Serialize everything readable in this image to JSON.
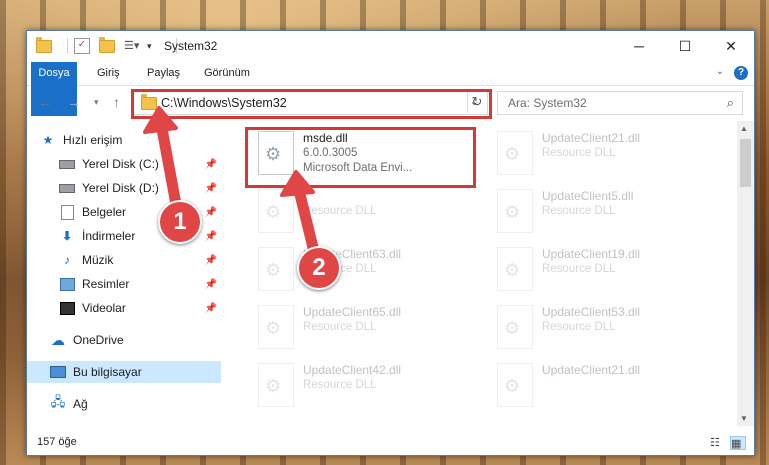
{
  "window": {
    "title": "System32",
    "controls": {
      "minimize": "─",
      "maximize": "☐",
      "close": "✕"
    }
  },
  "ribbon": {
    "tabs": [
      "Dosya",
      "Giriş",
      "Paylaş",
      "Görünüm"
    ]
  },
  "address": {
    "path": "C:\\Windows\\System32",
    "search_placeholder": "Ara: System32"
  },
  "nav": {
    "items": [
      {
        "label": "Hızlı erişim",
        "icon": "star-icon"
      },
      {
        "label": "Yerel Disk (C:)",
        "icon": "drive-icon",
        "pinned": true
      },
      {
        "label": "Yerel Disk (D:)",
        "icon": "drive-icon",
        "pinned": true
      },
      {
        "label": "Belgeler",
        "icon": "documents-icon",
        "pinned": true
      },
      {
        "label": "İndirmeler",
        "icon": "download-icon",
        "pinned": true
      },
      {
        "label": "Müzik",
        "icon": "music-icon",
        "pinned": true
      },
      {
        "label": "Resimler",
        "icon": "pictures-icon",
        "pinned": true
      },
      {
        "label": "Videolar",
        "icon": "videos-icon",
        "pinned": true
      },
      {
        "label": "OneDrive",
        "icon": "cloud-icon"
      },
      {
        "label": "Bu bilgisayar",
        "icon": "computer-icon",
        "selected": true
      },
      {
        "label": "Ağ",
        "icon": "network-icon"
      }
    ]
  },
  "files": [
    {
      "name": "msde.dll",
      "version": "6.0.0.3005",
      "desc": "Microsoft Data Envi..."
    },
    {
      "name": "UpdateClient21.dll",
      "desc": "Resource DLL"
    },
    {
      "name": "",
      "desc": "Resource DLL"
    },
    {
      "name": "UpdateClient5.dll",
      "desc": "Resource DLL"
    },
    {
      "name": "UpdateClient63.dll",
      "desc": "Resource DLL"
    },
    {
      "name": "UpdateClient19.dll",
      "desc": "Resource DLL"
    },
    {
      "name": "UpdateClient65.dll",
      "desc": "Resource DLL"
    },
    {
      "name": "UpdateClient53.dll",
      "desc": "Resource DLL"
    },
    {
      "name": "UpdateClient42.dll",
      "desc": "Resource DLL"
    },
    {
      "name": "UpdateClient21.dll",
      "desc": ""
    }
  ],
  "status": {
    "count": "157 öğe"
  },
  "annotations": {
    "step1": "1",
    "step2": "2"
  },
  "colors": {
    "accent": "#1a6fc9",
    "highlight": "#d23a3a",
    "selected": "#cce8ff"
  }
}
